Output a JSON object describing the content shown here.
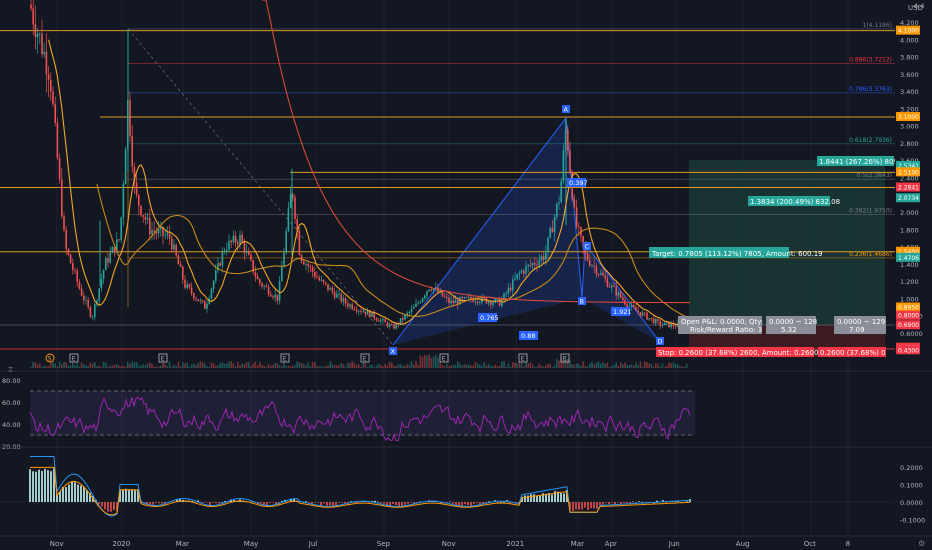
{
  "chart_data": {
    "type": "candlestick",
    "currency_label": "USD",
    "x_axis": {
      "labels": [
        "Nov",
        "2020",
        "Mar",
        "May",
        "Jul",
        "Sep",
        "Nov",
        "2021",
        "Mar",
        "Apr",
        "Jun",
        "Aug",
        "Oct",
        "8"
      ]
    },
    "price_panel": {
      "ylim": [
        0.4,
        4.4
      ],
      "tick_labels": [
        "4.4",
        "4.200",
        "4.000",
        "3.800",
        "3.600",
        "3.400",
        "3.200",
        "3.000",
        "2.800",
        "2.600",
        "2.400",
        "2.200",
        "2.000",
        "1.800",
        "1.600",
        "1.400",
        "1.200",
        "1.000",
        "0.8000",
        "0.6000"
      ],
      "tick_values": [
        4.4,
        4.2,
        4.0,
        3.8,
        3.6,
        3.4,
        3.2,
        3.0,
        2.8,
        2.6,
        2.4,
        2.2,
        2.0,
        1.8,
        1.6,
        1.4,
        1.2,
        1.0,
        0.8,
        0.6
      ],
      "price_tags": [
        {
          "text": "4.1000",
          "value": 4.1,
          "color": "#ff9800"
        },
        {
          "text": "3.1000",
          "value": 3.1,
          "color": "#ff9800"
        },
        {
          "text": "2.5341",
          "value": 2.5341,
          "color": "#26a69a"
        },
        {
          "text": "2.5100",
          "value": 2.46,
          "color": "#ff9800"
        },
        {
          "text": "2.2841",
          "value": 2.2841,
          "color": "#f23645"
        },
        {
          "text": "2.0734",
          "value": 2.16,
          "color": "#26a69a"
        },
        {
          "text": "1.5400",
          "value": 1.54,
          "color": "#ff9800"
        },
        {
          "text": "1.4706",
          "value": 1.47,
          "color": "#26a69a"
        },
        {
          "text": "0.8950",
          "value": 0.895,
          "color": "#ff9800"
        },
        {
          "text": "0.8000",
          "value": 0.8,
          "color": "#f23645"
        },
        {
          "text": "0.6900",
          "value": 0.69,
          "color": "#f23645"
        },
        {
          "text": "0.4300",
          "value": 0.43,
          "color": "#f23645"
        },
        {
          "text": "0.4300",
          "value": 0.4,
          "color": "#f23645"
        }
      ],
      "fib_levels": [
        {
          "label": "1(4.1186)",
          "value": 4.12,
          "color": "#787b86"
        },
        {
          "label": "0.886(3.7212)",
          "value": 3.72,
          "color": "#f23645"
        },
        {
          "label": "0.786(3.3763)",
          "value": 3.38,
          "color": "#2962ff"
        },
        {
          "label": "0.618(2.7936)",
          "value": 2.79,
          "color": "#26a69a"
        },
        {
          "label": "0.5(2.3843)",
          "value": 2.38,
          "color": "#787b86"
        },
        {
          "label": "0.382(1.9750)",
          "value": 1.97,
          "color": "#787b86"
        },
        {
          "label": "0.236(1.4686)",
          "value": 1.47,
          "color": "#ff9800"
        }
      ],
      "pattern_points": [
        {
          "label": "X",
          "color": "#2962ff"
        },
        {
          "label": "A",
          "color": "#2962ff"
        },
        {
          "label": "B",
          "color": "#2962ff"
        },
        {
          "label": "C",
          "color": "#2962ff"
        },
        {
          "label": "D",
          "color": "#2962ff"
        }
      ],
      "pattern_ratios": [
        "0.765",
        "0.88",
        "0.397",
        "1.921"
      ],
      "position_labels": {
        "target": "Target: 0.7805 (113.12%) 7805, Amount: 600.19",
        "tp2": "1.8441 (267.26%) 809.27",
        "tp1": "1.3834 (200.49%) 632.08",
        "stop": "Stop: 0.2600 (37.68%) 2600, Amount: 0.2600 (37.68%) 0",
        "stop_right": "0.2600 (37.68%) 0",
        "open_pl": "Open P&L: 0.0000, Qty: 128",
        "risk_reward": "Risk/Reward Ratio: 3",
        "box1": [
          "0.0000 ~ 128",
          "5.32"
        ],
        "box2": [
          "0.0000 ~ 129",
          "7.09"
        ]
      },
      "event_badges": [
        "S",
        "E",
        "E",
        "E",
        "E",
        "E",
        "E",
        "E"
      ],
      "symbol_letter": "Z"
    },
    "rsi_panel": {
      "ylim": [
        20,
        80
      ],
      "tick_labels": [
        "80.00",
        "60.00",
        "40.00",
        "20.00"
      ],
      "tick_values": [
        80,
        60,
        40,
        20
      ],
      "bands": [
        70,
        30
      ]
    },
    "macd_panel": {
      "ylim": [
        -0.14,
        0.26
      ],
      "tick_labels": [
        "0.2000",
        "0.1000",
        "0.0000",
        "-0.1000"
      ],
      "tick_values": [
        0.2,
        0.1,
        0.0,
        -0.1
      ]
    },
    "colors": {
      "background": "#131722",
      "up": "#26a69a",
      "down": "#ef5350",
      "ma_orange": "#f5a623",
      "ma_red": "#d9473a",
      "rsi": "#9c27b0",
      "macd": "#2196f3",
      "signal": "#ff9800"
    }
  }
}
